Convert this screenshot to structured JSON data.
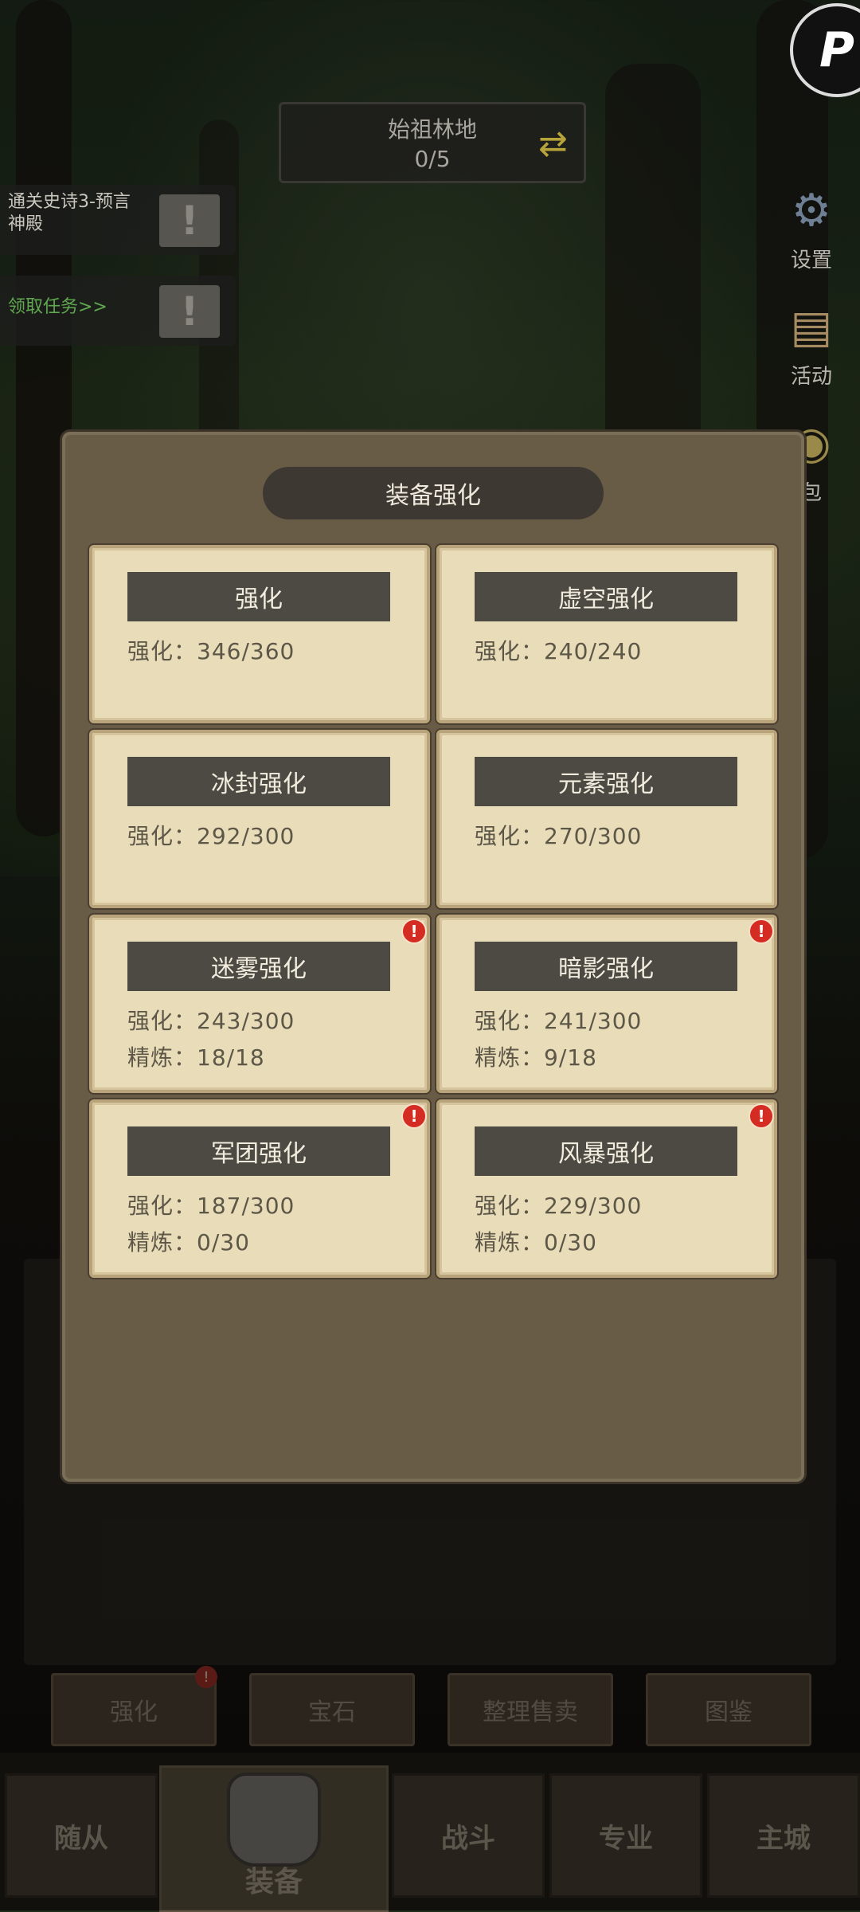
{
  "hud": {
    "location_name": "始祖林地",
    "location_count": "0/5",
    "swap_icon": "⇄",
    "logo_letter": "P"
  },
  "quests": [
    {
      "text": "通关史诗3-预言神殿",
      "alert": "!"
    },
    {
      "text": "领取任务>>",
      "alert": "!"
    }
  ],
  "side_buttons": [
    {
      "label": "设置",
      "icon": "⚙"
    },
    {
      "label": "活动",
      "icon": "▤"
    },
    {
      "label": "包",
      "icon": "◉"
    }
  ],
  "modal": {
    "title": "装备强化",
    "cards": [
      {
        "name": "强化",
        "line1": "强化：346/360",
        "line2": "",
        "alert": false
      },
      {
        "name": "虚空强化",
        "line1": "强化：240/240",
        "line2": "",
        "alert": false
      },
      {
        "name": "冰封强化",
        "line1": "强化：292/300",
        "line2": "",
        "alert": false
      },
      {
        "name": "元素强化",
        "line1": "强化：270/300",
        "line2": "",
        "alert": false
      },
      {
        "name": "迷雾强化",
        "line1": "强化：243/300",
        "line2": "精炼：18/18",
        "alert": true
      },
      {
        "name": "暗影强化",
        "line1": "强化：241/300",
        "line2": "精炼：9/18",
        "alert": true
      },
      {
        "name": "军团强化",
        "line1": "强化：187/300",
        "line2": "精炼：0/30",
        "alert": true
      },
      {
        "name": "风暴强化",
        "line1": "强化：229/300",
        "line2": "精炼：0/30",
        "alert": true
      }
    ],
    "alert_glyph": "!"
  },
  "sub_tabs": [
    {
      "label": "强化",
      "badge": "!"
    },
    {
      "label": "宝石",
      "badge": ""
    },
    {
      "label": "整理售卖",
      "badge": ""
    },
    {
      "label": "图鉴",
      "badge": ""
    }
  ],
  "bottom_nav": [
    {
      "label": "随从"
    },
    {
      "label": "装备"
    },
    {
      "label": "战斗"
    },
    {
      "label": "专业"
    },
    {
      "label": "主城"
    }
  ]
}
